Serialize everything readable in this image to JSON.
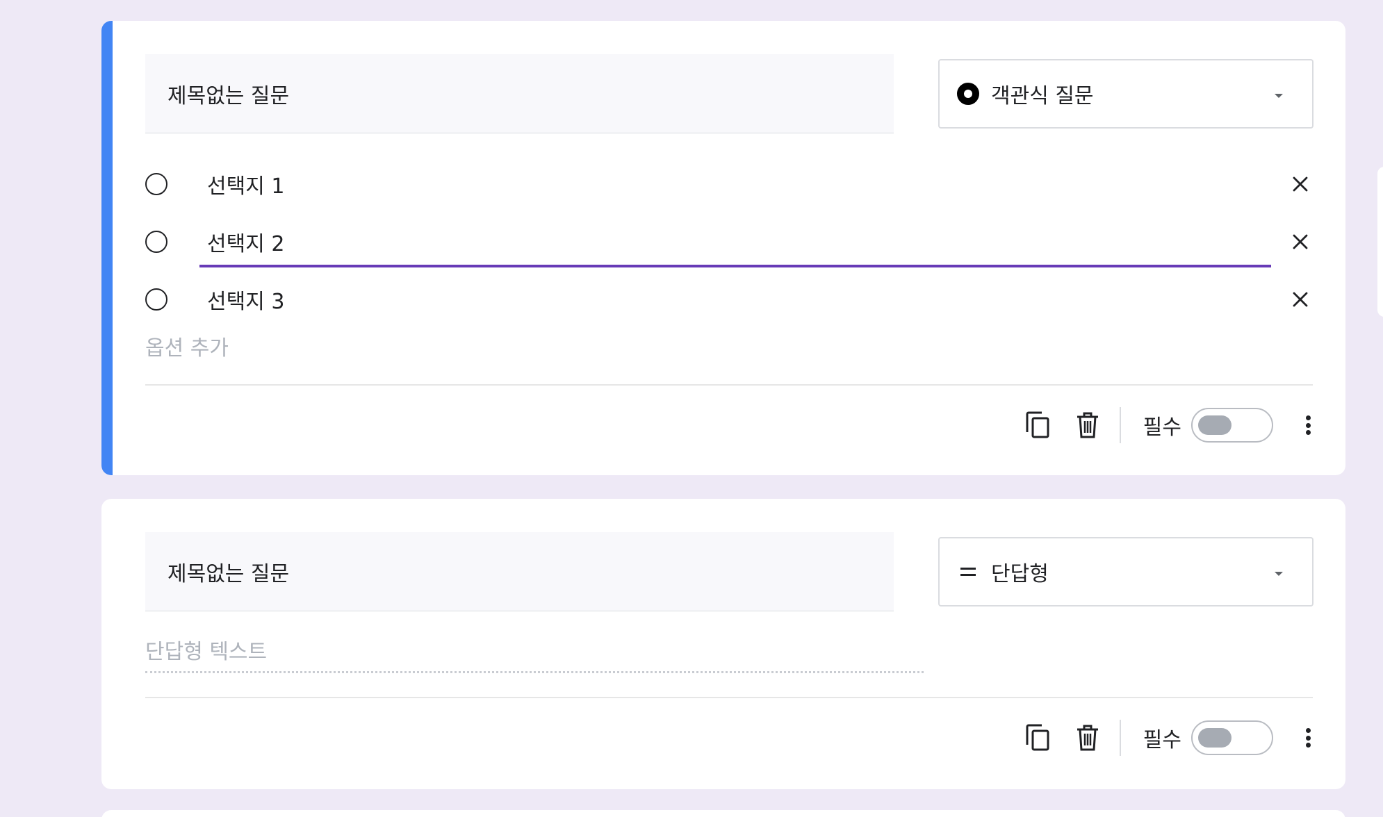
{
  "colors": {
    "page_bg": "#EEE9F6",
    "active_accent": "#4285F4",
    "focus_underline": "#673AB7",
    "placeholder": "#AEB3BB"
  },
  "questions": [
    {
      "title": "제목없는 질문",
      "type_label": "객관식 질문",
      "type_icon": "radio-button-icon",
      "active": true,
      "options": [
        {
          "label": "선택지 1"
        },
        {
          "label": "선택지 2"
        },
        {
          "label": "선택지 3"
        }
      ],
      "add_option_label": "옵션 추가",
      "required_label": "필수",
      "required": false
    },
    {
      "title": "제목없는 질문",
      "type_label": "단답형",
      "type_icon": "short-answer-icon",
      "active": false,
      "answer_placeholder": "단답형 텍스트",
      "required_label": "필수",
      "required": false
    }
  ]
}
